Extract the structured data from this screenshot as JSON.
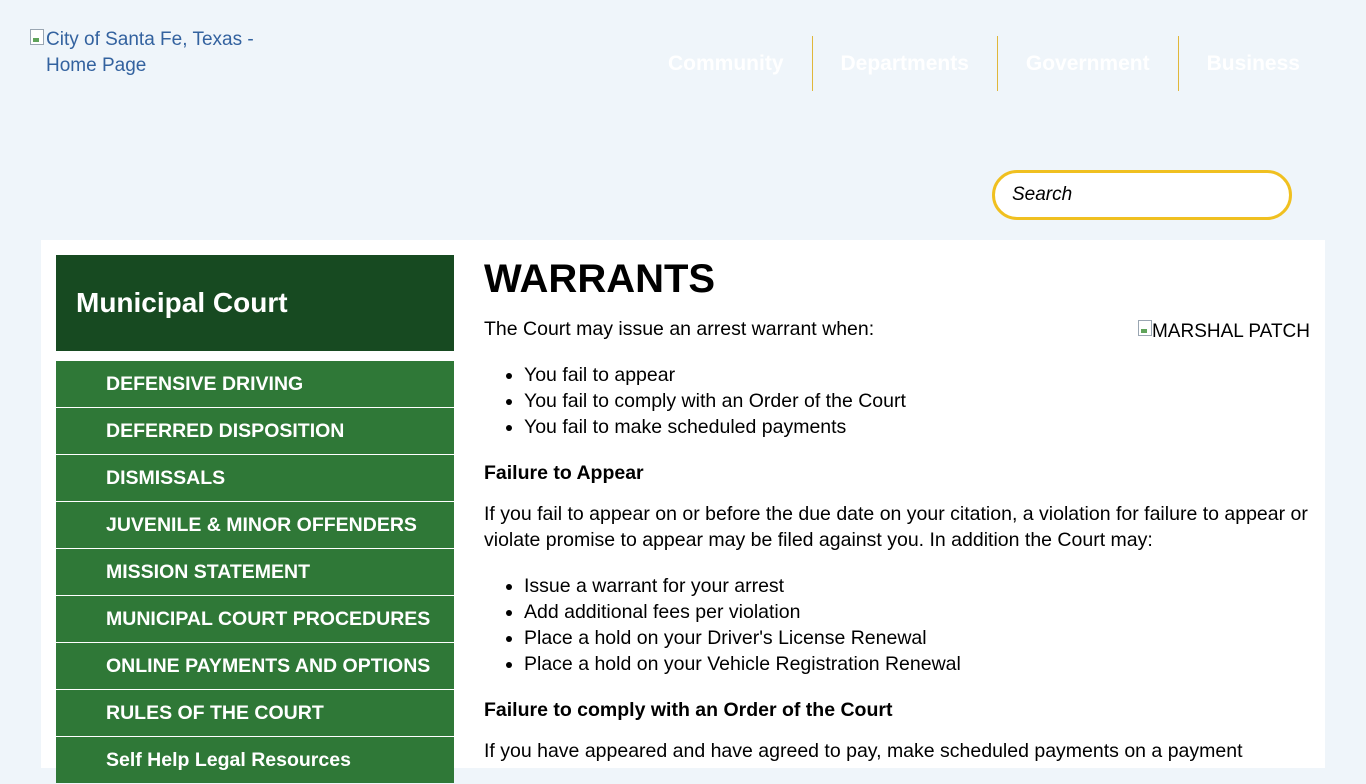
{
  "header": {
    "logo_alt": "City of Santa Fe, Texas - Home Page",
    "nav": [
      "Community",
      "Departments",
      "Government",
      "Business"
    ],
    "search_placeholder": "Search"
  },
  "sidebar": {
    "title": "Municipal Court",
    "items": [
      "DEFENSIVE DRIVING",
      "DEFERRED DISPOSITION",
      "DISMISSALS",
      "JUVENILE & MINOR OFFENDERS",
      "MISSION STATEMENT",
      "MUNICIPAL COURT PROCEDURES",
      "ONLINE PAYMENTS AND OPTIONS",
      "RULES OF THE COURT",
      "Self Help Legal Resources"
    ]
  },
  "article": {
    "title": "WARRANTS",
    "patch_alt": "MARSHAL PATCH",
    "intro": "The Court may issue an arrest warrant when:",
    "reasons": [
      "You fail to appear",
      "You fail to comply with an Order of the Court",
      "You fail to make scheduled payments"
    ],
    "fta_heading": "Failure to Appear",
    "fta_text": "If you fail to appear on or before the due date on your citation, a violation for failure to appear or violate promise to appear may be filed against you.  In addition the Court may:",
    "fta_consequences": [
      "Issue a warrant for your arrest",
      "Add additional fees per violation",
      "Place a hold on your Driver's License Renewal",
      "Place a hold on your Vehicle Registration Renewal"
    ],
    "ftc_heading": "Failure to comply with an Order of the Court",
    "ftc_text": "If you have appeared and have agreed to pay, make scheduled payments on a payment"
  }
}
